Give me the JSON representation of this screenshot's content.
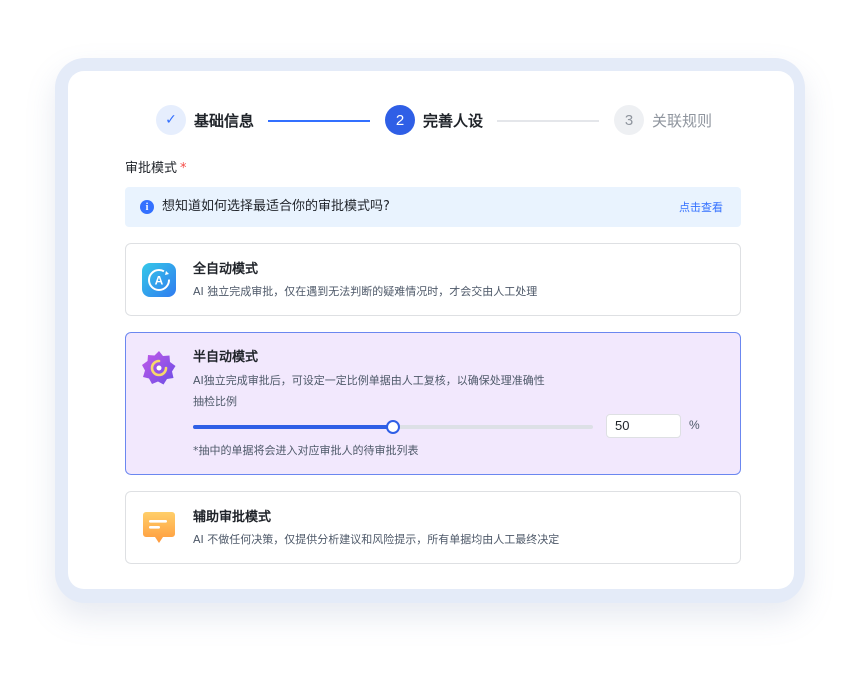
{
  "stepper": {
    "steps": [
      {
        "index": "✓",
        "label": "基础信息",
        "status": "done"
      },
      {
        "index": "2",
        "label": "完善人设",
        "status": "active"
      },
      {
        "index": "3",
        "label": "关联规则",
        "status": "todo"
      }
    ]
  },
  "approval_mode": {
    "label": "审批模式",
    "required_mark": "*",
    "info": {
      "icon": "info-icon",
      "text": "想知道如何选择最适合你的审批模式吗?",
      "link": "点击查看"
    },
    "modes": [
      {
        "icon": "auto-mode-icon",
        "title": "全自动模式",
        "desc": "AI 独立完成审批，仅在遇到无法判断的疑难情况时，才会交由人工处理",
        "selected": false
      },
      {
        "icon": "semi-auto-mode-icon",
        "title": "半自动模式",
        "desc": "AI独立完成审批后，可设定一定比例单据由人工复核，以确保处理准确性",
        "sample_label": "抽检比例",
        "sample_value": "50",
        "sample_fraction": 0.5,
        "unit": "%",
        "note": "*抽中的单据将会进入对应审批人的待审批列表",
        "selected": true
      },
      {
        "icon": "assist-mode-icon",
        "title": "辅助审批模式",
        "desc": "AI 不做任何决策，仅提供分析建议和风险提示，所有单据均由人工最终决定",
        "selected": false
      }
    ]
  },
  "colors": {
    "accent": "#2f5fe6",
    "selected_bg": "#f2e8fd",
    "info_bg": "#e9f3fe",
    "required": "#f54a45"
  }
}
